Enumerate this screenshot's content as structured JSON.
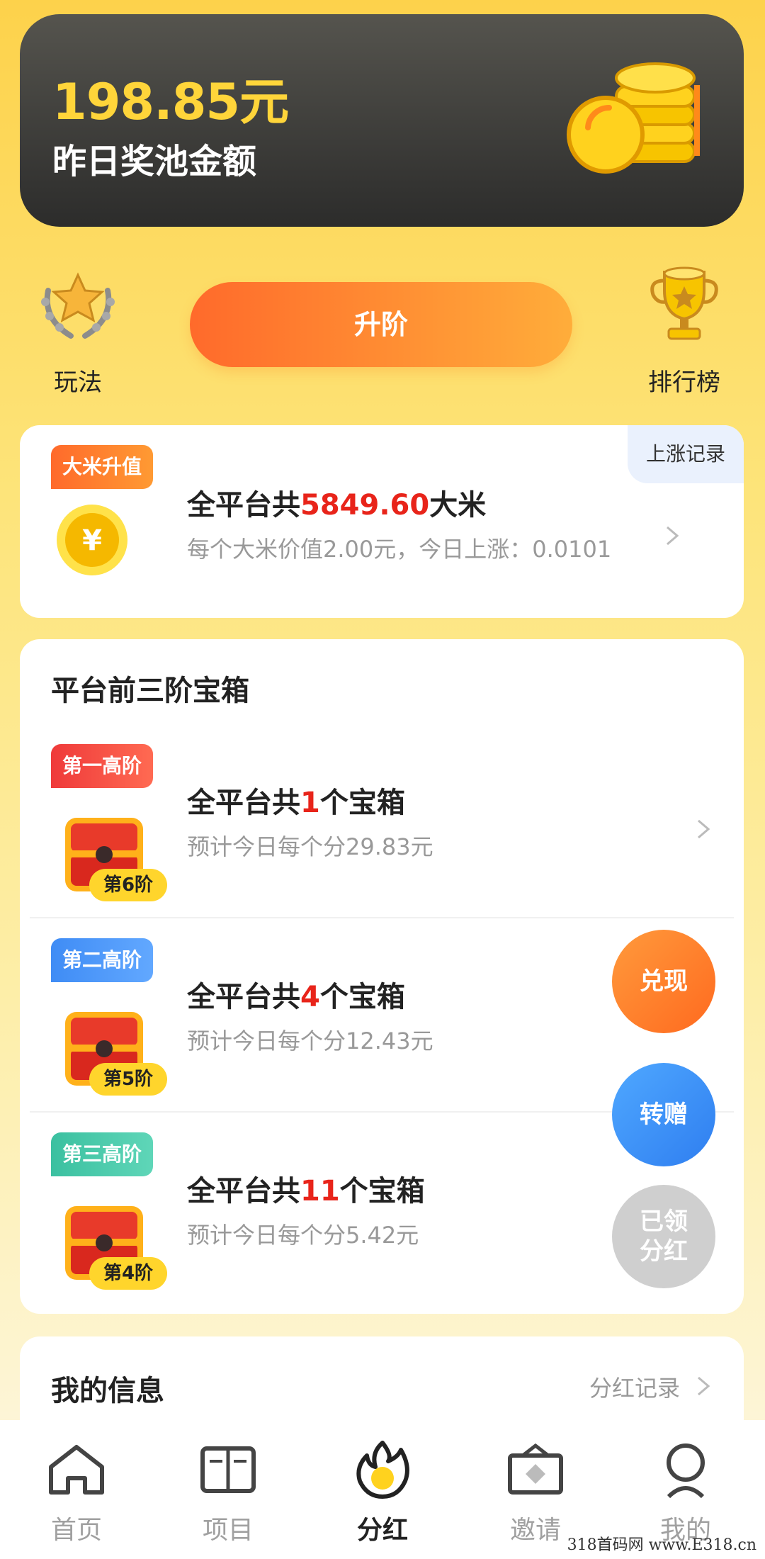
{
  "pool": {
    "amount": "198.85元",
    "label": "昨日奖池金额"
  },
  "actions": {
    "play_label": "玩法",
    "upgrade_label": "升阶",
    "ranking_label": "排行榜"
  },
  "rice": {
    "tag": "大米升值",
    "rise_record": "上涨记录",
    "title_prefix": "全平台共",
    "title_amount": "5849.60",
    "title_suffix": "大米",
    "subtitle": "每个大米价值2.00元，今日上涨：0.0101"
  },
  "tiers": {
    "title": "平台前三阶宝箱",
    "items": [
      {
        "tag": "第一高阶",
        "level": "第6阶",
        "prefix": "全平台共",
        "count": "1",
        "suffix": "个宝箱",
        "estimate": "预计今日每个分29.83元"
      },
      {
        "tag": "第二高阶",
        "level": "第5阶",
        "prefix": "全平台共",
        "count": "4",
        "suffix": "个宝箱",
        "estimate": "预计今日每个分12.43元"
      },
      {
        "tag": "第三高阶",
        "level": "第4阶",
        "prefix": "全平台共",
        "count": "11",
        "suffix": "个宝箱",
        "estimate": "预计今日每个分5.42元"
      }
    ]
  },
  "float_buttons": {
    "cash": "兑现",
    "gift": "转赠",
    "claimed_line1": "已领",
    "claimed_line2": "分红"
  },
  "my_info": {
    "title": "我的信息",
    "link": "分红记录"
  },
  "nav": {
    "items": [
      {
        "label": "首页",
        "icon": "home-icon"
      },
      {
        "label": "项目",
        "icon": "book-icon"
      },
      {
        "label": "分红",
        "icon": "flame-icon",
        "active": true
      },
      {
        "label": "邀请",
        "icon": "envelope-icon"
      },
      {
        "label": "我的",
        "icon": "profile-icon"
      }
    ]
  },
  "watermark": "318首码网 www.E318.cn",
  "colors": {
    "accent_orange": "#ff6a2b",
    "gold": "#ffd53a",
    "red_highlight": "#e8241a",
    "blue": "#3f8cf5",
    "green": "#3bc0a0"
  }
}
